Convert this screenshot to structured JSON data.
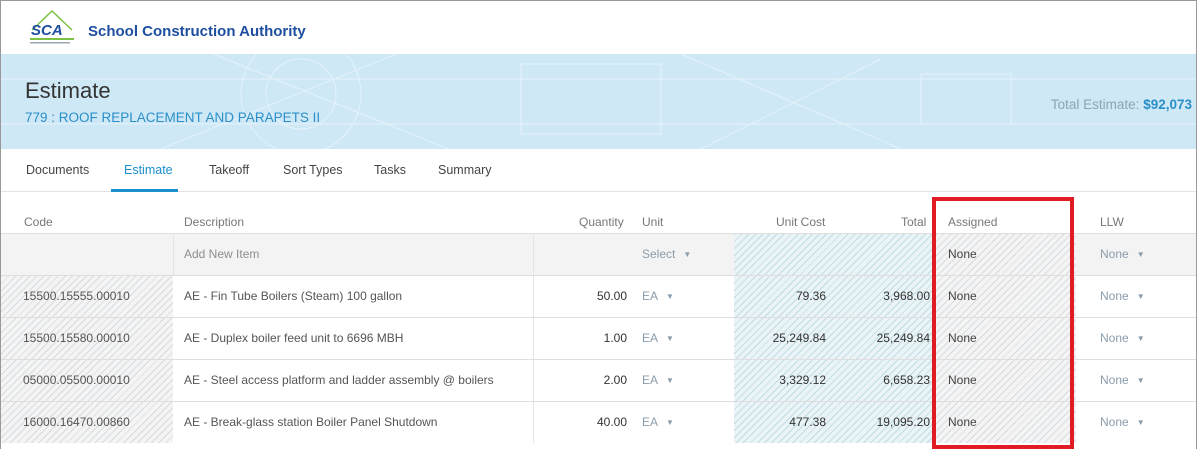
{
  "app": {
    "logo_abbr": "SCA",
    "logo_tagline": "School Construction Authority",
    "title": "School Construction Authority"
  },
  "header": {
    "page_title": "Estimate",
    "project": "779 : ROOF REPLACEMENT AND PARAPETS II",
    "total_label": "Total Estimate: ",
    "total_value": "$92,073"
  },
  "tabs": [
    {
      "label": "Documents",
      "active": false
    },
    {
      "label": "Estimate",
      "active": true
    },
    {
      "label": "Takeoff",
      "active": false
    },
    {
      "label": "Sort Types",
      "active": false
    },
    {
      "label": "Tasks",
      "active": false
    },
    {
      "label": "Summary",
      "active": false
    }
  ],
  "columns": {
    "code": "Code",
    "description": "Description",
    "quantity": "Quantity",
    "unit": "Unit",
    "unit_cost": "Unit Cost",
    "total": "Total",
    "assigned": "Assigned",
    "llw": "LLW"
  },
  "add_row": {
    "placeholder": "Add New Item",
    "unit_select": "Select",
    "assigned": "None",
    "llw": "None"
  },
  "rows": [
    {
      "code": "15500.15555.00010",
      "description": "AE - Fin Tube Boilers (Steam) 100 gallon",
      "quantity": "50.00",
      "unit": "EA",
      "unit_cost": "79.36",
      "total": "3,968.00",
      "assigned": "None",
      "llw": "None"
    },
    {
      "code": "15500.15580.00010",
      "description": "AE - Duplex boiler feed unit to 6696 MBH",
      "quantity": "1.00",
      "unit": "EA",
      "unit_cost": "25,249.84",
      "total": "25,249.84",
      "assigned": "None",
      "llw": "None"
    },
    {
      "code": "05000.05500.00010",
      "description": "AE - Steel access platform and ladder assembly @ boilers",
      "quantity": "2.00",
      "unit": "EA",
      "unit_cost": "3,329.12",
      "total": "6,658.23",
      "assigned": "None",
      "llw": "None"
    },
    {
      "code": "16000.16470.00860",
      "description": "AE - Break-glass station Boiler Panel Shutdown",
      "quantity": "40.00",
      "unit": "EA",
      "unit_cost": "477.38",
      "total": "19,095.20",
      "assigned": "None",
      "llw": "None"
    }
  ],
  "colors": {
    "accent": "#1c8fcf",
    "brand": "#1f4fa0",
    "highlight": "#e01b22",
    "hero_bg": "#cfe8f6"
  },
  "icons": {
    "logo": "sca-logo-icon",
    "caret": "caret-down-icon"
  }
}
